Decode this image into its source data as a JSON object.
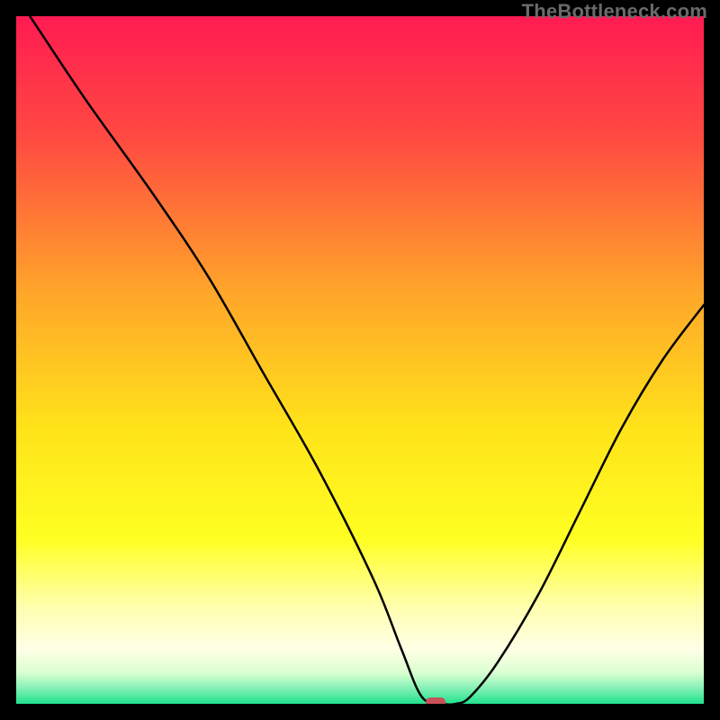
{
  "watermark": "TheBottleneck.com",
  "chart_data": {
    "type": "line",
    "title": "",
    "xlabel": "",
    "ylabel": "",
    "xlim": [
      0,
      100
    ],
    "ylim": [
      0,
      100
    ],
    "grid": false,
    "legend": false,
    "marker": {
      "x": 61,
      "y": 0,
      "color": "#c94f58"
    },
    "gradient_stops": [
      {
        "offset": 0.0,
        "color": "#ff1b52"
      },
      {
        "offset": 0.18,
        "color": "#ff4b41"
      },
      {
        "offset": 0.4,
        "color": "#ffa52a"
      },
      {
        "offset": 0.6,
        "color": "#ffe31a"
      },
      {
        "offset": 0.76,
        "color": "#ffff22"
      },
      {
        "offset": 0.86,
        "color": "#ffffb0"
      },
      {
        "offset": 0.92,
        "color": "#ffffe6"
      },
      {
        "offset": 0.955,
        "color": "#d9ffd0"
      },
      {
        "offset": 0.975,
        "color": "#8ef2b8"
      },
      {
        "offset": 1.0,
        "color": "#20e28e"
      }
    ],
    "series": [
      {
        "name": "bottleneck-curve",
        "x": [
          2,
          10,
          20,
          28,
          36,
          44,
          52,
          56,
          59,
          62,
          64,
          66,
          70,
          76,
          82,
          88,
          94,
          100
        ],
        "y": [
          100,
          88,
          74,
          62,
          48,
          34,
          18,
          8,
          1,
          0,
          0,
          1,
          6,
          16,
          28,
          40,
          50,
          58
        ]
      }
    ]
  }
}
